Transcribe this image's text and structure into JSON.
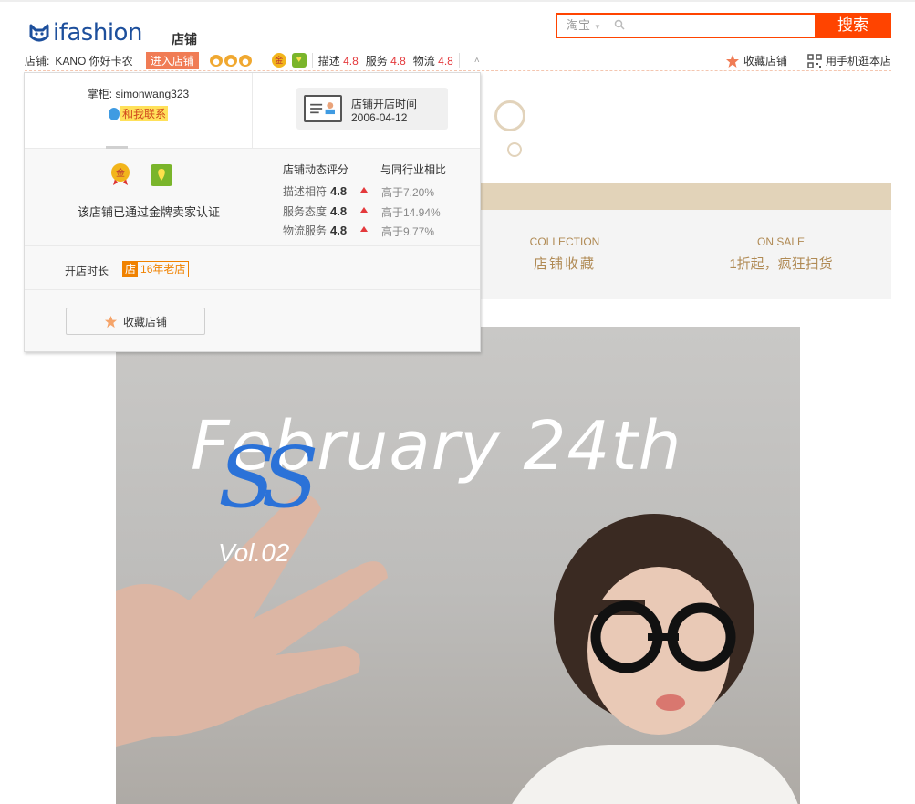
{
  "header": {
    "logo_text": "ifashion",
    "store_word": "店铺",
    "search": {
      "scope": "淘宝",
      "placeholder": "",
      "button": "搜索"
    },
    "infobar": {
      "shop_prefix": "店铺:",
      "shop_name": "KANO 你好卡农",
      "enter_btn": "进入店铺",
      "gold_badge_char": "金",
      "dsr": [
        {
          "label": "描述",
          "value": "4.8"
        },
        {
          "label": "服务",
          "value": "4.8"
        },
        {
          "label": "物流",
          "value": "4.8"
        }
      ],
      "caret": "˄"
    },
    "fav_label": "收藏店铺",
    "mobile_label": "用手机逛本店"
  },
  "banner": {
    "nav": [
      {
        "en": "COLLECTION",
        "cn": "店铺收藏"
      },
      {
        "en": "ON SALE",
        "cn": "1折起，疯狂扫货"
      }
    ]
  },
  "hero": {
    "title": "February 24th",
    "ss": "SS",
    "vol": "Vol.02"
  },
  "popup": {
    "keeper_label": "掌柜:",
    "keeper_name": "simonwang323",
    "contact": "和我联系",
    "open_time_label": "店铺开店时间",
    "open_date": "2006-04-12",
    "cert_text": "该店铺已通过金牌卖家认证",
    "dsr_head": "店铺动态评分",
    "cmp_head": "与同行业相比",
    "dsr_rows": [
      {
        "label": "描述相符",
        "score": "4.8",
        "cmp": "高于7.20%"
      },
      {
        "label": "服务态度",
        "score": "4.8",
        "cmp": "高于14.94%"
      },
      {
        "label": "物流服务",
        "score": "4.8",
        "cmp": "高于9.77%"
      }
    ],
    "age_label": "开店时长",
    "age_shop": "店",
    "age_text": "16年老店",
    "fav_btn": "收藏店铺"
  },
  "colors": {
    "accent": "#ff4400",
    "link_red": "#e4393c",
    "tan": "#e2d3b9",
    "gold_text": "#b08a54"
  }
}
